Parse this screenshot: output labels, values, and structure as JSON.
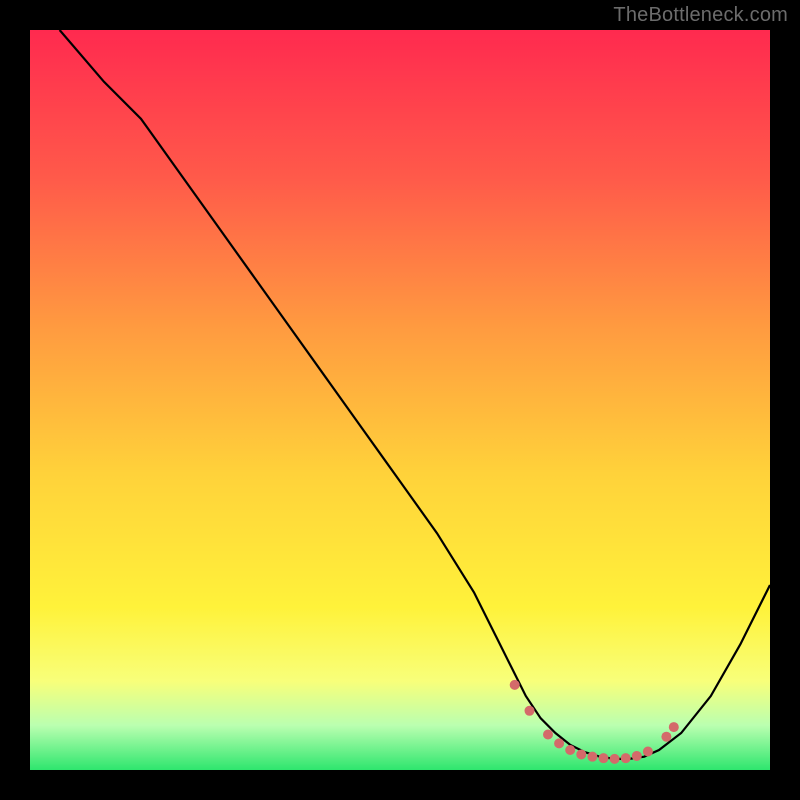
{
  "watermark": "TheBottleneck.com",
  "chart_data": {
    "type": "line",
    "title": "",
    "xlabel": "",
    "ylabel": "",
    "xlim": [
      0,
      100
    ],
    "ylim": [
      0,
      100
    ],
    "grid": false,
    "legend": false,
    "background_gradient": {
      "stops": [
        {
          "offset": 0.0,
          "color": "#ff2a4f"
        },
        {
          "offset": 0.2,
          "color": "#ff5a4a"
        },
        {
          "offset": 0.4,
          "color": "#ff9a40"
        },
        {
          "offset": 0.6,
          "color": "#ffd23a"
        },
        {
          "offset": 0.78,
          "color": "#fff23a"
        },
        {
          "offset": 0.88,
          "color": "#f8ff7a"
        },
        {
          "offset": 0.94,
          "color": "#baffb0"
        },
        {
          "offset": 1.0,
          "color": "#2ee66e"
        }
      ]
    },
    "series": [
      {
        "name": "bottleneck-curve",
        "color": "#000000",
        "width": 2.2,
        "x": [
          4,
          10,
          15,
          20,
          25,
          30,
          35,
          40,
          45,
          50,
          55,
          60,
          63,
          65,
          67,
          69,
          71,
          73,
          75,
          77,
          79,
          81,
          83,
          85,
          88,
          92,
          96,
          100
        ],
        "y": [
          100,
          93,
          88,
          81,
          74,
          67,
          60,
          53,
          46,
          39,
          32,
          24,
          18,
          14,
          10,
          7,
          5,
          3.4,
          2.4,
          1.8,
          1.5,
          1.5,
          1.8,
          2.7,
          5,
          10,
          17,
          25
        ]
      }
    ],
    "markers": {
      "name": "optimal-range",
      "color": "#d46a6a",
      "radius": 5,
      "points": [
        {
          "x": 65.5,
          "y": 11.5
        },
        {
          "x": 67.5,
          "y": 8.0
        },
        {
          "x": 70.0,
          "y": 4.8
        },
        {
          "x": 71.5,
          "y": 3.6
        },
        {
          "x": 73.0,
          "y": 2.7
        },
        {
          "x": 74.5,
          "y": 2.1
        },
        {
          "x": 76.0,
          "y": 1.8
        },
        {
          "x": 77.5,
          "y": 1.6
        },
        {
          "x": 79.0,
          "y": 1.5
        },
        {
          "x": 80.5,
          "y": 1.6
        },
        {
          "x": 82.0,
          "y": 1.9
        },
        {
          "x": 83.5,
          "y": 2.5
        },
        {
          "x": 86.0,
          "y": 4.5
        },
        {
          "x": 87.0,
          "y": 5.8
        }
      ]
    }
  }
}
